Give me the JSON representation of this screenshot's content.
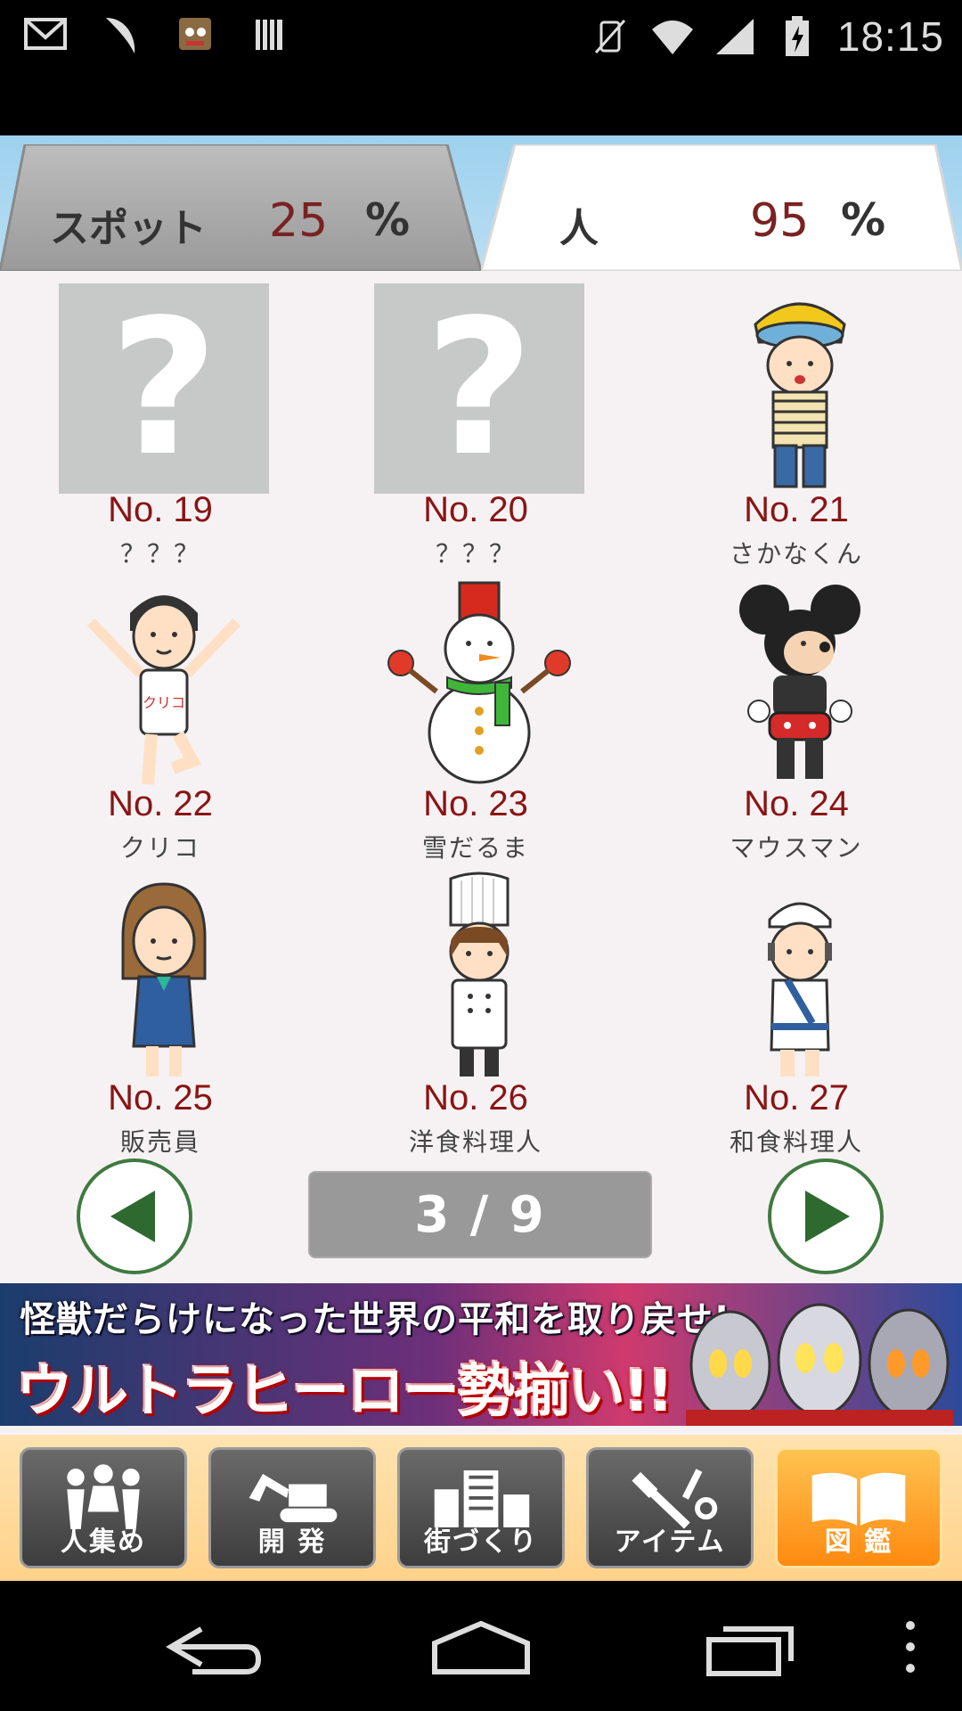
{
  "status_bar": {
    "time": "18:15",
    "left_icons": [
      "gmail-icon",
      "feather-icon",
      "game-app-icon",
      "barcode-icon"
    ],
    "right_icons": [
      "vibrate-off-icon",
      "wifi-icon",
      "signal-icon",
      "battery-charging-icon"
    ]
  },
  "tabs": {
    "spot": {
      "label": "スポット",
      "value": "25",
      "unit": "%"
    },
    "people": {
      "label": "人",
      "value": "95",
      "unit": "%"
    }
  },
  "entries": [
    {
      "number": "No. 19",
      "name": "？？？",
      "unknown": true,
      "icon": "unknown-question-icon"
    },
    {
      "number": "No. 20",
      "name": "？？？",
      "unknown": true,
      "icon": "unknown-question-icon"
    },
    {
      "number": "No. 21",
      "name": "さかなくん",
      "unknown": false,
      "icon": "sakanakun-character-icon"
    },
    {
      "number": "No. 22",
      "name": "クリコ",
      "unknown": false,
      "icon": "kuriko-runner-character-icon"
    },
    {
      "number": "No. 23",
      "name": "雪だるま",
      "unknown": false,
      "icon": "snowman-character-icon"
    },
    {
      "number": "No. 24",
      "name": "マウスマン",
      "unknown": false,
      "icon": "mouseman-character-icon"
    },
    {
      "number": "No. 25",
      "name": "販売員",
      "unknown": false,
      "icon": "salesclerk-character-icon"
    },
    {
      "number": "No. 26",
      "name": "洋食料理人",
      "unknown": false,
      "icon": "western-chef-character-icon"
    },
    {
      "number": "No. 27",
      "name": "和食料理人",
      "unknown": false,
      "icon": "japanese-chef-character-icon"
    }
  ],
  "pager": {
    "label": "3 / 9",
    "current": 3,
    "total": 9
  },
  "banner": {
    "line1": "怪獣だらけになった世界の平和を取り戻せ!",
    "line2": "ウルトラヒーロー勢揃い!!"
  },
  "nav": [
    {
      "label": "人集め",
      "icon": "people-gather-icon",
      "active": false
    },
    {
      "label": "開 発",
      "icon": "excavator-icon",
      "active": false
    },
    {
      "label": "街づくり",
      "icon": "buildings-icon",
      "active": false
    },
    {
      "label": "アイテム",
      "icon": "tools-icon",
      "active": false
    },
    {
      "label": "図 鑑",
      "icon": "book-icon",
      "active": true
    }
  ],
  "colors": {
    "number_red": "#8a1414",
    "active_tab_bg": "#ffffff",
    "inactive_tab_bg": "#a9a9a9",
    "arrow_green": "#3f7a40",
    "nav_active": "#ff8a10"
  }
}
